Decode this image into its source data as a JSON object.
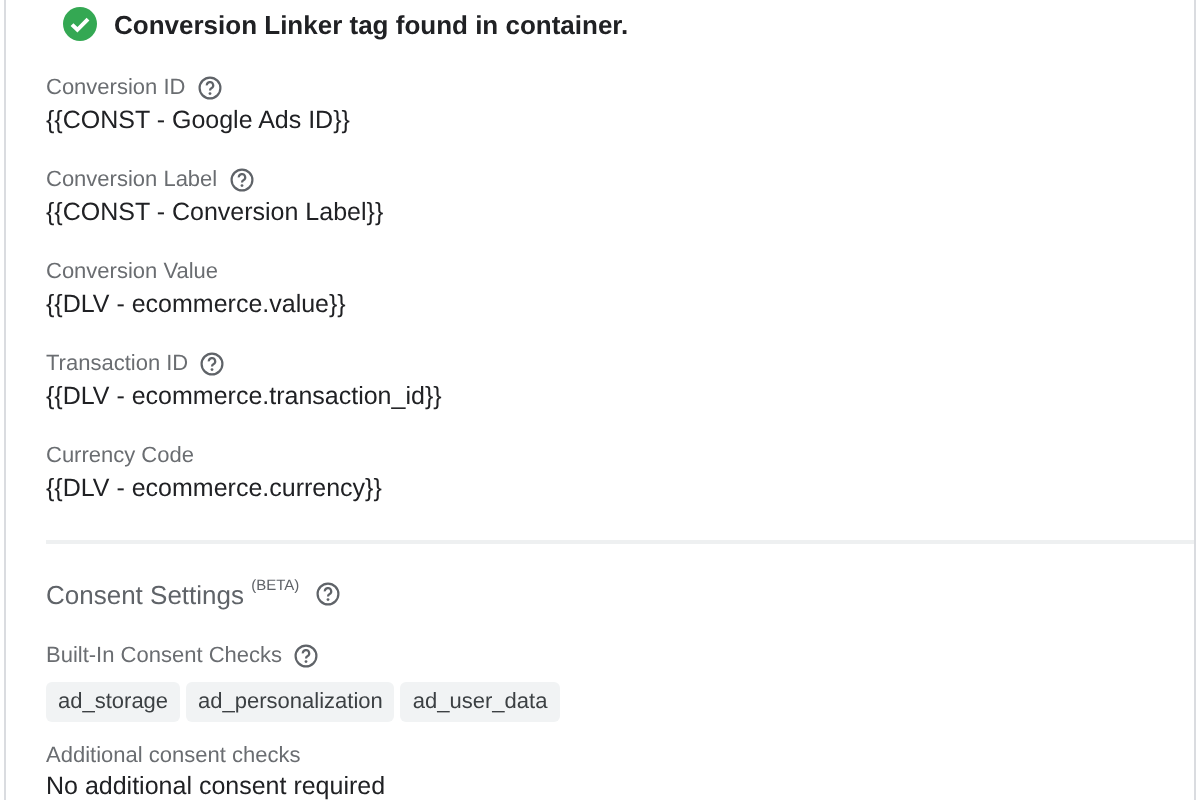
{
  "status": {
    "kind": "success",
    "message": "Conversion Linker tag found in container."
  },
  "fields": [
    {
      "label": "Conversion ID",
      "help": true,
      "value": "{{CONST - Google Ads ID}}"
    },
    {
      "label": "Conversion Label",
      "help": true,
      "value": "{{CONST - Conversion Label}}"
    },
    {
      "label": "Conversion Value",
      "help": false,
      "value": "{{DLV - ecommerce.value}}"
    },
    {
      "label": "Transaction ID",
      "help": true,
      "value": "{{DLV - ecommerce.transaction_id}}"
    },
    {
      "label": "Currency Code",
      "help": false,
      "value": "{{DLV - ecommerce.currency}}"
    }
  ],
  "consent": {
    "title": "Consent Settings $^{(BETA)}$",
    "help": true,
    "builtin": {
      "label": "Built-In Consent Checks",
      "help": true,
      "chips": [
        "ad_storage",
        "ad_personalization",
        "ad_user_data"
      ]
    },
    "additional": {
      "label": "Additional consent checks",
      "value": "No additional consent required"
    }
  }
}
